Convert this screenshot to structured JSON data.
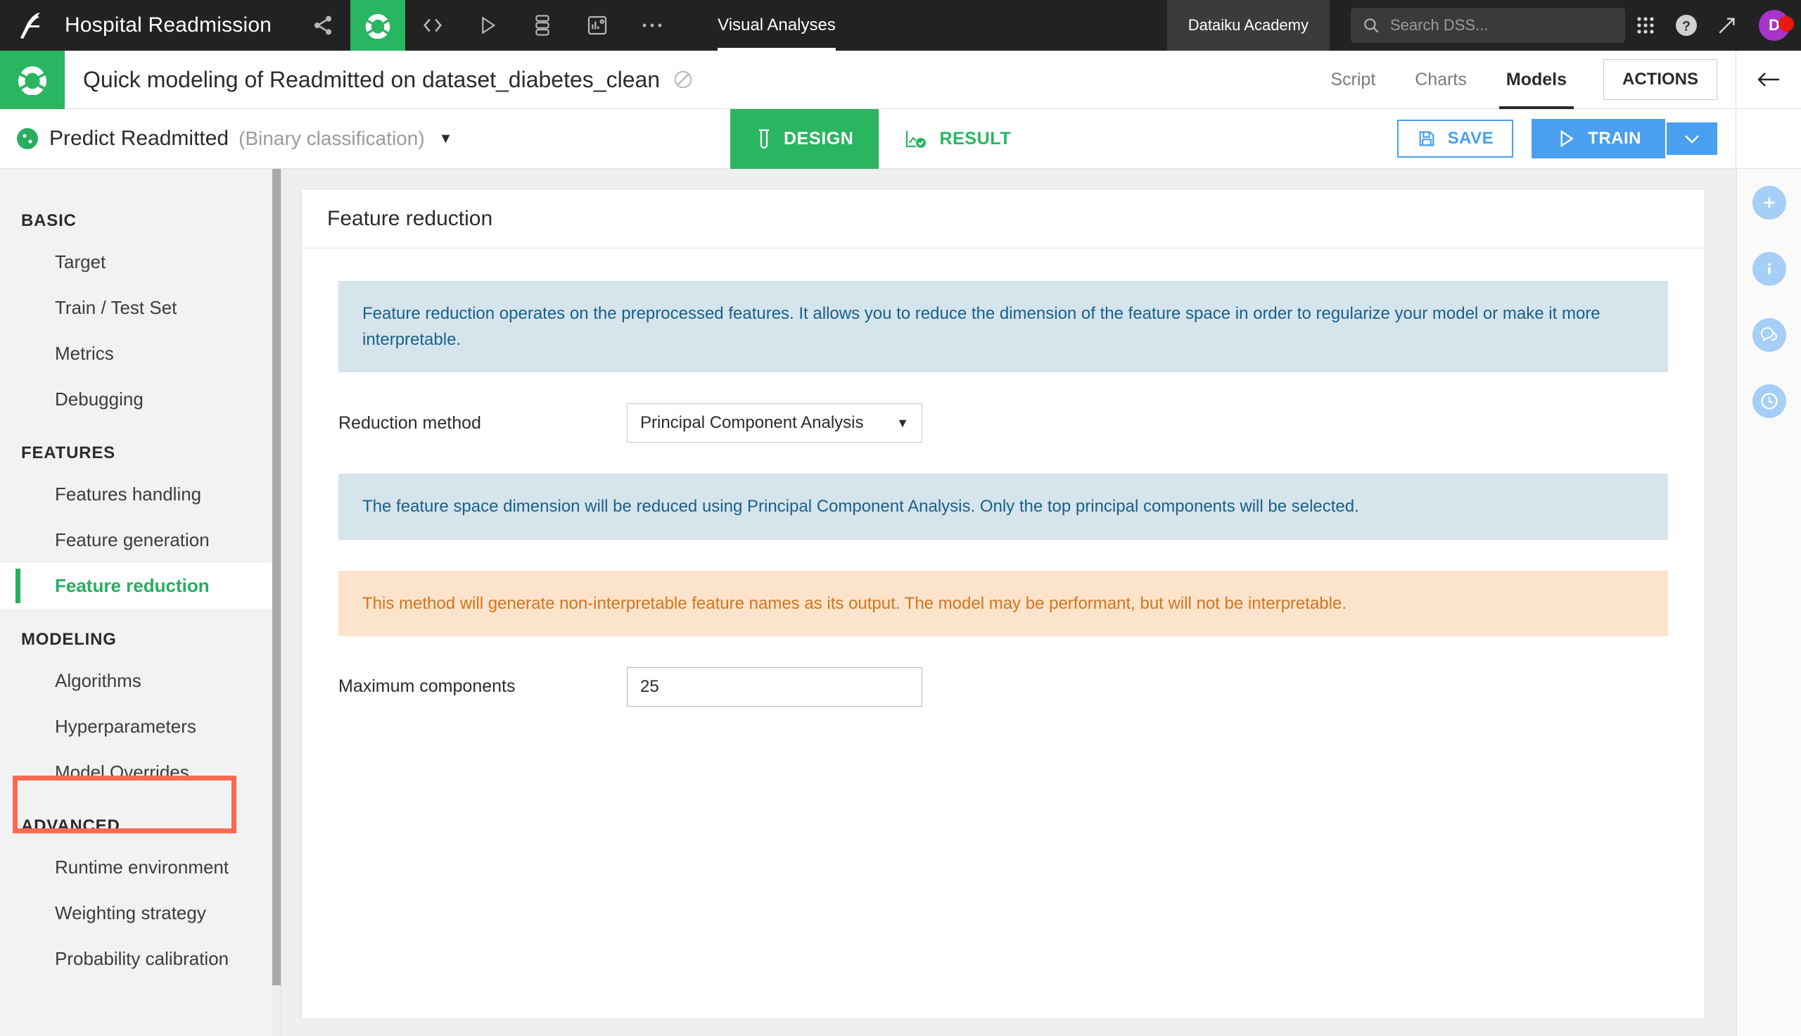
{
  "topnav": {
    "project_title": "Hospital Readmission",
    "logo_icon": "dataiku-bird-logo",
    "icons": [
      {
        "name": "flow-share-icon",
        "glyph": "share"
      },
      {
        "name": "lab-icon",
        "glyph": "lab",
        "active": true
      },
      {
        "name": "code-icon",
        "glyph": "code"
      },
      {
        "name": "run-icon",
        "glyph": "play"
      },
      {
        "name": "jobs-icon",
        "glyph": "stack"
      },
      {
        "name": "dashboard-icon",
        "glyph": "dashboard"
      },
      {
        "name": "more-icon",
        "glyph": "ellipsis"
      }
    ],
    "section_label": "Visual Analyses",
    "academy_label": "Dataiku Academy",
    "search_placeholder": "Search DSS...",
    "search_value": "",
    "right_icons": [
      {
        "name": "apps-grid-icon"
      },
      {
        "name": "help-icon"
      },
      {
        "name": "trending-icon"
      }
    ],
    "avatar_initial": "D",
    "avatar_color": "#a833c9",
    "notification_color": "#e8190f"
  },
  "header": {
    "analysis_title": "Quick modeling of Readmitted on dataset_diabetes_clean",
    "tabs": [
      {
        "label": "Script",
        "active": false
      },
      {
        "label": "Charts",
        "active": false
      },
      {
        "label": "Models",
        "active": true
      }
    ],
    "actions_label": "ACTIONS"
  },
  "modelbar": {
    "model_name": "Predict Readmitted",
    "model_type": "(Binary classification)",
    "design_label": "DESIGN",
    "result_label": "RESULT",
    "save_label": "SAVE",
    "train_label": "TRAIN"
  },
  "sidebar": {
    "groups": [
      {
        "title": "BASIC",
        "items": [
          {
            "label": "Target",
            "active": false
          },
          {
            "label": "Train / Test Set",
            "active": false
          },
          {
            "label": "Metrics",
            "active": false
          },
          {
            "label": "Debugging",
            "active": false
          }
        ]
      },
      {
        "title": "FEATURES",
        "items": [
          {
            "label": "Features handling",
            "active": false
          },
          {
            "label": "Feature generation",
            "active": false
          },
          {
            "label": "Feature reduction",
            "active": true
          }
        ]
      },
      {
        "title": "MODELING",
        "items": [
          {
            "label": "Algorithms",
            "active": false
          },
          {
            "label": "Hyperparameters",
            "active": false
          },
          {
            "label": "Model Overrides",
            "active": false
          }
        ]
      },
      {
        "title": "ADVANCED",
        "items": [
          {
            "label": "Runtime environment",
            "active": false
          },
          {
            "label": "Weighting strategy",
            "active": false
          },
          {
            "label": "Probability calibration",
            "active": false
          }
        ]
      }
    ],
    "annotation_color": "#fb6a50",
    "active_color": "#27ae60"
  },
  "main": {
    "panel_title": "Feature reduction",
    "info_banner_1": "Feature reduction operates on the preprocessed features. It allows you to reduce the dimension of the feature space in order to regularize your model or make it more interpretable.",
    "reduction_method_label": "Reduction method",
    "reduction_method_value": "Principal Component Analysis",
    "info_banner_2": "The feature space dimension will be reduced using Principal Component Analysis. Only the top principal components will be selected.",
    "warn_banner": "This method will generate non-interpretable feature names as its output. The model may be performant, but will not be interpretable.",
    "max_components_label": "Maximum components",
    "max_components_value": "25"
  },
  "rightrail": {
    "icons": [
      {
        "name": "back-arrow-icon"
      },
      {
        "name": "add-icon"
      },
      {
        "name": "info-icon"
      },
      {
        "name": "discussions-icon"
      },
      {
        "name": "history-icon"
      }
    ]
  }
}
